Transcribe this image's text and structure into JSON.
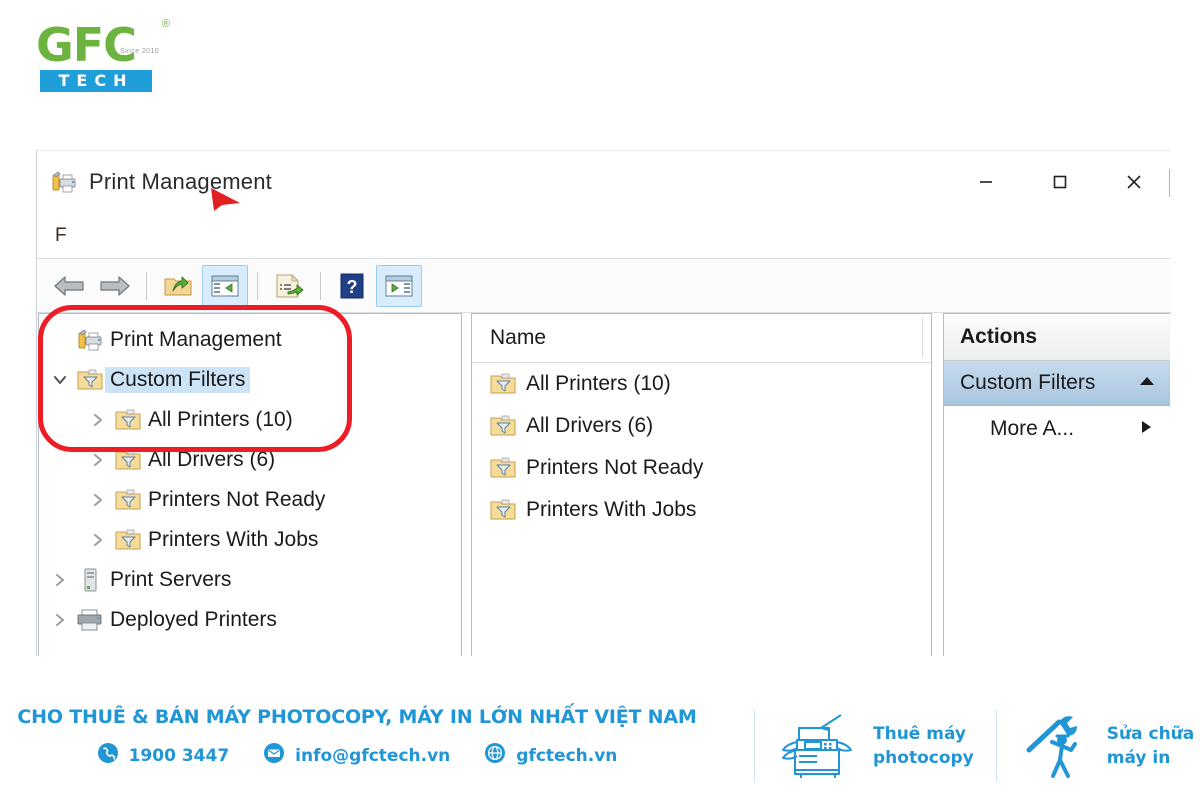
{
  "brand": {
    "name_main": "GFC",
    "registered_mark": "®",
    "since": "Since 2010",
    "name_sub": "TECH",
    "green": "#6cb33f",
    "blue": "#1f9ed9"
  },
  "window": {
    "title": "Print Management",
    "title_icon": "print-management-icon",
    "controls": {
      "minimize": "minimize-icon",
      "maximize": "maximize-icon",
      "close": "close-icon"
    },
    "menubar": {
      "items": [
        {
          "label": "F"
        }
      ]
    },
    "toolbar": {
      "buttons": [
        {
          "name": "back-button",
          "icon": "back-arrow-icon",
          "selected": false
        },
        {
          "name": "forward-button",
          "icon": "forward-arrow-icon",
          "selected": false
        },
        {
          "name": "up-one-level-button",
          "icon": "up-folder-icon",
          "selected": false
        },
        {
          "name": "show-hide-console-tree-button",
          "icon": "console-tree-icon",
          "selected": true
        },
        {
          "name": "export-list-button",
          "icon": "export-list-icon",
          "selected": false
        },
        {
          "name": "help-button",
          "icon": "question-mark-icon",
          "selected": false
        },
        {
          "name": "show-hide-action-pane-button",
          "icon": "action-pane-icon",
          "selected": true
        }
      ]
    }
  },
  "tree": {
    "nodes": [
      {
        "label": "Print Management",
        "icon": "print-management-icon",
        "twisty": "none",
        "level": 0,
        "selected": false
      },
      {
        "label": "Custom Filters",
        "icon": "filter-folder-icon",
        "twisty": "expanded",
        "level": 0,
        "selected": true
      },
      {
        "label": "All Printers (10)",
        "icon": "filter-folder-icon",
        "twisty": "collapsed",
        "level": 1,
        "selected": false
      },
      {
        "label": "All Drivers (6)",
        "icon": "filter-folder-icon",
        "twisty": "collapsed",
        "level": 1,
        "selected": false
      },
      {
        "label": "Printers Not Ready",
        "icon": "filter-folder-icon",
        "twisty": "collapsed",
        "level": 1,
        "selected": false
      },
      {
        "label": "Printers With Jobs",
        "icon": "filter-folder-icon",
        "twisty": "collapsed",
        "level": 1,
        "selected": false
      },
      {
        "label": "Print Servers",
        "icon": "server-icon",
        "twisty": "collapsed",
        "level": 0,
        "selected": false
      },
      {
        "label": "Deployed Printers",
        "icon": "printer-icon",
        "twisty": "collapsed",
        "level": 0,
        "selected": false
      }
    ]
  },
  "list": {
    "columns": [
      "Name"
    ],
    "rows": [
      {
        "name": "All Printers (10)",
        "icon": "filter-folder-icon"
      },
      {
        "name": "All Drivers (6)",
        "icon": "filter-folder-icon"
      },
      {
        "name": "Printers Not Ready",
        "icon": "filter-folder-icon"
      },
      {
        "name": "Printers With Jobs",
        "icon": "filter-folder-icon"
      }
    ]
  },
  "actions": {
    "header": "Actions",
    "group": "Custom Filters",
    "group_chevron": "chevron-up-icon",
    "items": [
      {
        "label": "More A...",
        "arrow": "triangle-right-icon"
      }
    ]
  },
  "annotations": {
    "highlight_box_color": "#ee1c24",
    "cursor_color": "#e02020"
  },
  "footer": {
    "tagline": "CHO THUÊ & BÁN MÁY PHOTOCOPY, MÁY IN LỚN NHẤT VIỆT NAM",
    "contacts": [
      {
        "icon": "phone-icon",
        "text": "1900 3447"
      },
      {
        "icon": "email-icon",
        "text": "info@gfctech.vn"
      },
      {
        "icon": "globe-icon",
        "text": "gfctech.vn"
      }
    ],
    "services": [
      {
        "icon": "copier-icon",
        "line1": "Thuê máy",
        "line2": "photocopy"
      },
      {
        "icon": "repair-worker-icon",
        "line1": "Sửa chữa",
        "line2": "máy in"
      }
    ],
    "accent": "#2196d6"
  }
}
